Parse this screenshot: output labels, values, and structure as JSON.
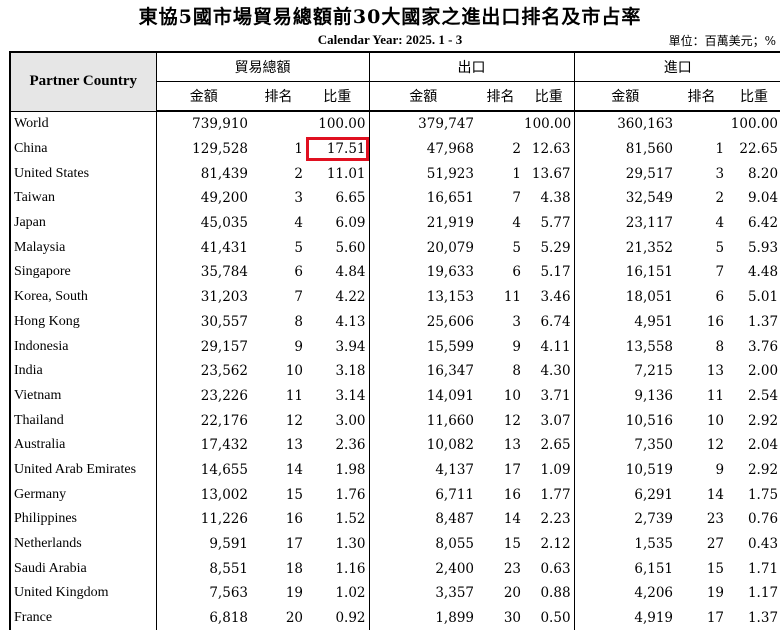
{
  "title": "東協5國市場貿易總額前30大國家之進出口排名及市占率",
  "subtitle": "Calendar Year: 2025. 1 - 3",
  "unit": "單位：百萬美元；%",
  "headers": {
    "partner": "Partner Country",
    "groups": [
      "貿易總額",
      "出口",
      "進口"
    ],
    "sub": [
      "金額",
      "排名",
      "比重"
    ]
  },
  "highlight": {
    "row": 1,
    "column": "total_share",
    "color": "#e01020"
  },
  "rows": [
    {
      "country": "World",
      "total_amount": "739,910",
      "total_rank": "",
      "total_share": "100.00",
      "export_amount": "379,747",
      "export_rank": "",
      "export_share": "100.00",
      "import_amount": "360,163",
      "import_rank": "",
      "import_share": "100.00"
    },
    {
      "country": "China",
      "total_amount": "129,528",
      "total_rank": "1",
      "total_share": "17.51",
      "export_amount": "47,968",
      "export_rank": "2",
      "export_share": "12.63",
      "import_amount": "81,560",
      "import_rank": "1",
      "import_share": "22.65"
    },
    {
      "country": "United States",
      "total_amount": "81,439",
      "total_rank": "2",
      "total_share": "11.01",
      "export_amount": "51,923",
      "export_rank": "1",
      "export_share": "13.67",
      "import_amount": "29,517",
      "import_rank": "3",
      "import_share": "8.20"
    },
    {
      "country": "Taiwan",
      "total_amount": "49,200",
      "total_rank": "3",
      "total_share": "6.65",
      "export_amount": "16,651",
      "export_rank": "7",
      "export_share": "4.38",
      "import_amount": "32,549",
      "import_rank": "2",
      "import_share": "9.04"
    },
    {
      "country": "Japan",
      "total_amount": "45,035",
      "total_rank": "4",
      "total_share": "6.09",
      "export_amount": "21,919",
      "export_rank": "4",
      "export_share": "5.77",
      "import_amount": "23,117",
      "import_rank": "4",
      "import_share": "6.42"
    },
    {
      "country": "Malaysia",
      "total_amount": "41,431",
      "total_rank": "5",
      "total_share": "5.60",
      "export_amount": "20,079",
      "export_rank": "5",
      "export_share": "5.29",
      "import_amount": "21,352",
      "import_rank": "5",
      "import_share": "5.93"
    },
    {
      "country": "Singapore",
      "total_amount": "35,784",
      "total_rank": "6",
      "total_share": "4.84",
      "export_amount": "19,633",
      "export_rank": "6",
      "export_share": "5.17",
      "import_amount": "16,151",
      "import_rank": "7",
      "import_share": "4.48"
    },
    {
      "country": "Korea, South",
      "total_amount": "31,203",
      "total_rank": "7",
      "total_share": "4.22",
      "export_amount": "13,153",
      "export_rank": "11",
      "export_share": "3.46",
      "import_amount": "18,051",
      "import_rank": "6",
      "import_share": "5.01"
    },
    {
      "country": "Hong Kong",
      "total_amount": "30,557",
      "total_rank": "8",
      "total_share": "4.13",
      "export_amount": "25,606",
      "export_rank": "3",
      "export_share": "6.74",
      "import_amount": "4,951",
      "import_rank": "16",
      "import_share": "1.37"
    },
    {
      "country": "Indonesia",
      "total_amount": "29,157",
      "total_rank": "9",
      "total_share": "3.94",
      "export_amount": "15,599",
      "export_rank": "9",
      "export_share": "4.11",
      "import_amount": "13,558",
      "import_rank": "8",
      "import_share": "3.76"
    },
    {
      "country": "India",
      "total_amount": "23,562",
      "total_rank": "10",
      "total_share": "3.18",
      "export_amount": "16,347",
      "export_rank": "8",
      "export_share": "4.30",
      "import_amount": "7,215",
      "import_rank": "13",
      "import_share": "2.00"
    },
    {
      "country": "Vietnam",
      "total_amount": "23,226",
      "total_rank": "11",
      "total_share": "3.14",
      "export_amount": "14,091",
      "export_rank": "10",
      "export_share": "3.71",
      "import_amount": "9,136",
      "import_rank": "11",
      "import_share": "2.54"
    },
    {
      "country": "Thailand",
      "total_amount": "22,176",
      "total_rank": "12",
      "total_share": "3.00",
      "export_amount": "11,660",
      "export_rank": "12",
      "export_share": "3.07",
      "import_amount": "10,516",
      "import_rank": "10",
      "import_share": "2.92"
    },
    {
      "country": "Australia",
      "total_amount": "17,432",
      "total_rank": "13",
      "total_share": "2.36",
      "export_amount": "10,082",
      "export_rank": "13",
      "export_share": "2.65",
      "import_amount": "7,350",
      "import_rank": "12",
      "import_share": "2.04"
    },
    {
      "country": "United Arab Emirates",
      "total_amount": "14,655",
      "total_rank": "14",
      "total_share": "1.98",
      "export_amount": "4,137",
      "export_rank": "17",
      "export_share": "1.09",
      "import_amount": "10,519",
      "import_rank": "9",
      "import_share": "2.92"
    },
    {
      "country": "Germany",
      "total_amount": "13,002",
      "total_rank": "15",
      "total_share": "1.76",
      "export_amount": "6,711",
      "export_rank": "16",
      "export_share": "1.77",
      "import_amount": "6,291",
      "import_rank": "14",
      "import_share": "1.75"
    },
    {
      "country": "Philippines",
      "total_amount": "11,226",
      "total_rank": "16",
      "total_share": "1.52",
      "export_amount": "8,487",
      "export_rank": "14",
      "export_share": "2.23",
      "import_amount": "2,739",
      "import_rank": "23",
      "import_share": "0.76"
    },
    {
      "country": "Netherlands",
      "total_amount": "9,591",
      "total_rank": "17",
      "total_share": "1.30",
      "export_amount": "8,055",
      "export_rank": "15",
      "export_share": "2.12",
      "import_amount": "1,535",
      "import_rank": "27",
      "import_share": "0.43"
    },
    {
      "country": "Saudi Arabia",
      "total_amount": "8,551",
      "total_rank": "18",
      "total_share": "1.16",
      "export_amount": "2,400",
      "export_rank": "23",
      "export_share": "0.63",
      "import_amount": "6,151",
      "import_rank": "15",
      "import_share": "1.71"
    },
    {
      "country": "United Kingdom",
      "total_amount": "7,563",
      "total_rank": "19",
      "total_share": "1.02",
      "export_amount": "3,357",
      "export_rank": "20",
      "export_share": "0.88",
      "import_amount": "4,206",
      "import_rank": "19",
      "import_share": "1.17"
    },
    {
      "country": "France",
      "total_amount": "6,818",
      "total_rank": "20",
      "total_share": "0.92",
      "export_amount": "1,899",
      "export_rank": "30",
      "export_share": "0.50",
      "import_amount": "4,919",
      "import_rank": "17",
      "import_share": "1.37"
    }
  ]
}
